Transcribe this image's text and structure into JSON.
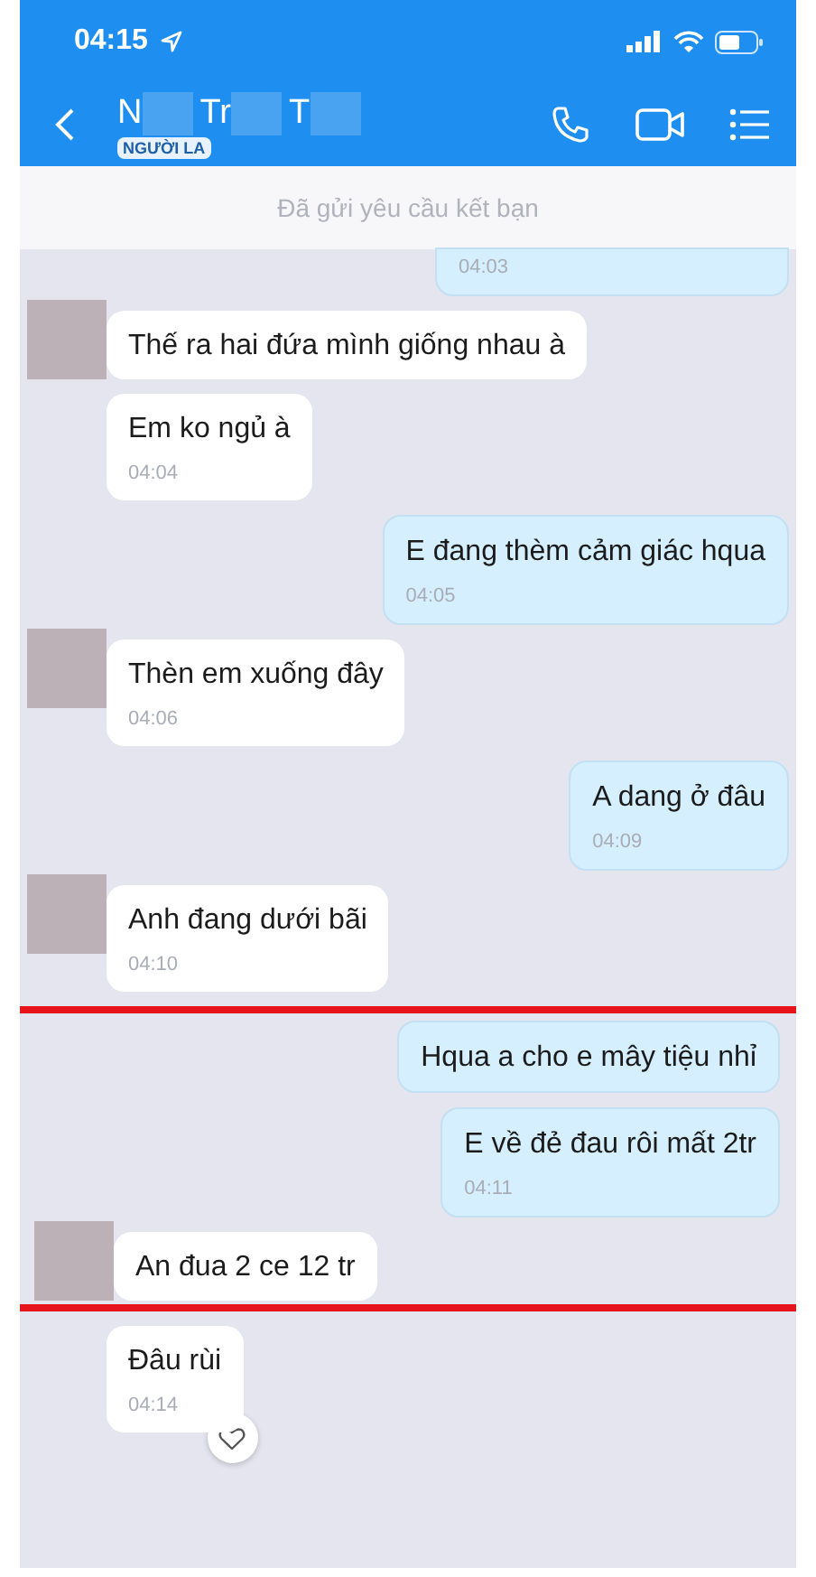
{
  "status_bar": {
    "time": "04:15"
  },
  "header": {
    "name_parts": [
      "N",
      "Tr",
      "T"
    ],
    "badge": "NGƯỜI LA"
  },
  "banner": "Đã gửi yêu cầu kết bạn",
  "groups": [
    {
      "highlighted": false,
      "messages": [
        {
          "kind": "sent",
          "time": "04:03"
        },
        {
          "kind": "received",
          "avatar": true,
          "text": "Thế ra hai đứa mình giống nhau à"
        },
        {
          "kind": "received",
          "avatar": false,
          "text": "Em ko ngủ à",
          "time": "04:04"
        },
        {
          "kind": "sent",
          "text": "E đang thèm cảm giác hqua",
          "time": "04:05"
        },
        {
          "kind": "received",
          "avatar": true,
          "text": "Thèn em xuống đây",
          "time": "04:06"
        },
        {
          "kind": "sent",
          "text": "A dang ở đâu",
          "time": "04:09"
        },
        {
          "kind": "received",
          "avatar": true,
          "text": "Anh đang dưới bãi",
          "time": "04:10"
        }
      ]
    },
    {
      "highlighted": true,
      "messages": [
        {
          "kind": "sent",
          "text": "Hqua a cho e mây tiệu nhỉ"
        },
        {
          "kind": "sent",
          "text": "E về đẻ đau rôi mất 2tr",
          "time": "04:11"
        },
        {
          "kind": "received",
          "avatar": true,
          "text": "An đua 2 ce 12 tr"
        }
      ]
    },
    {
      "highlighted": false,
      "messages": [
        {
          "kind": "received",
          "avatar": false,
          "text": "Đâu rùi",
          "time": "04:14",
          "reaction": true
        }
      ]
    }
  ]
}
